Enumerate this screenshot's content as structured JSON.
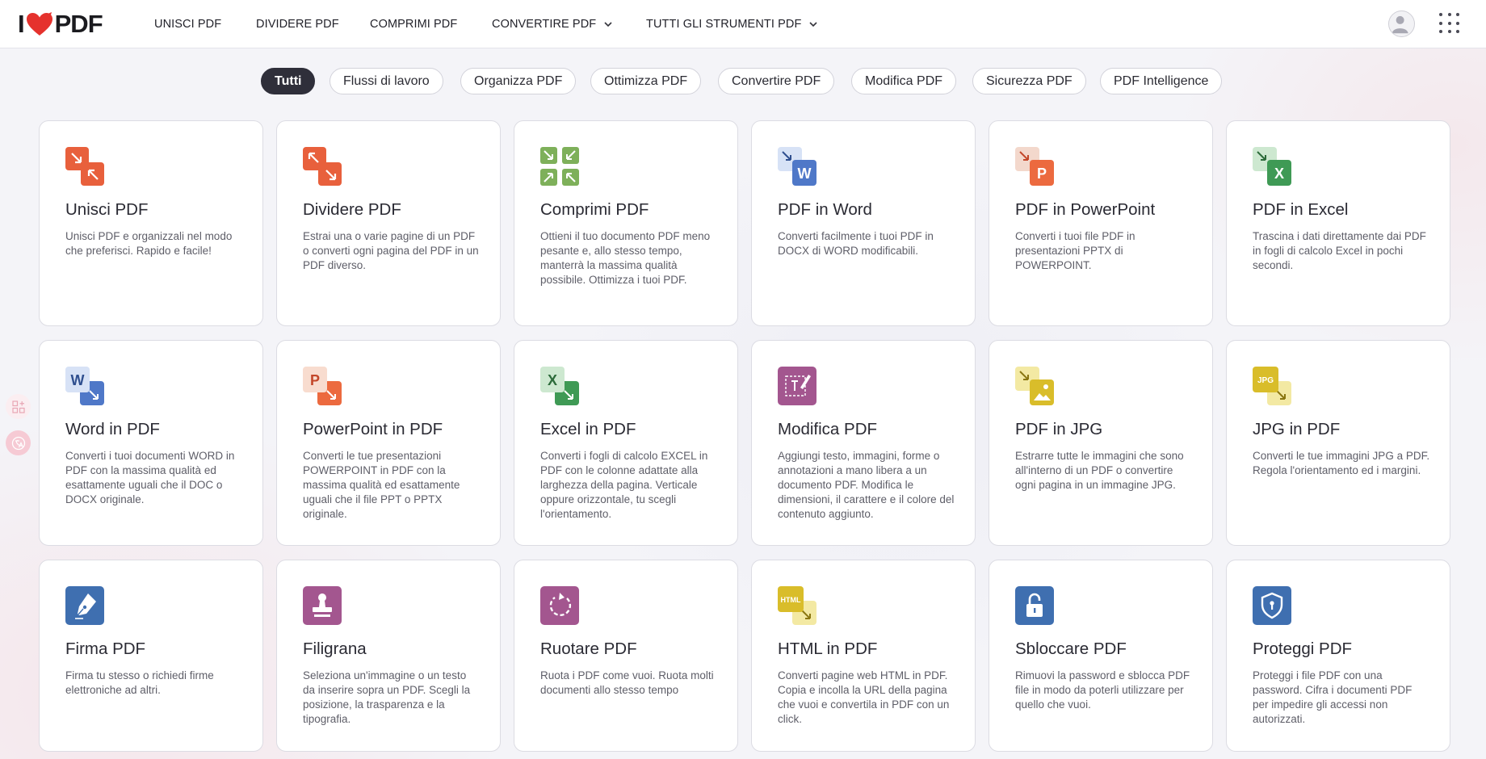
{
  "brand": {
    "logo_left": "I",
    "logo_right": "PDF",
    "accent": "#e5322d"
  },
  "nav": {
    "items": [
      {
        "label": "UNISCI PDF"
      },
      {
        "label": "DIVIDERE PDF"
      },
      {
        "label": "COMPRIMI PDF"
      },
      {
        "label": "CONVERTIRE PDF"
      },
      {
        "label": "TUTTI GLI STRUMENTI PDF"
      }
    ]
  },
  "filters": [
    {
      "label": "Tutti",
      "active": true
    },
    {
      "label": "Flussi di lavoro"
    },
    {
      "label": "Organizza PDF"
    },
    {
      "label": "Ottimizza PDF"
    },
    {
      "label": "Convertire PDF"
    },
    {
      "label": "Modifica PDF"
    },
    {
      "label": "Sicurezza PDF"
    },
    {
      "label": "PDF Intelligence"
    }
  ],
  "tools": [
    {
      "title": "Unisci PDF",
      "desc": "Unisci PDF e organizzali nel modo che preferisci. Rapido e facile!",
      "icon": "merge-icon",
      "color": "#e8603c"
    },
    {
      "title": "Dividere PDF",
      "desc": "Estrai una o varie pagine di un PDF o converti ogni pagina del PDF in un PDF diverso.",
      "icon": "split-icon",
      "color": "#e8603c"
    },
    {
      "title": "Comprimi PDF",
      "desc": "Ottieni il tuo documento PDF meno pesante e, allo stesso tempo, manterrà la massima qualità possibile. Ottimizza i tuoi PDF.",
      "icon": "compress-icon",
      "color": "#7eb05a"
    },
    {
      "title": "PDF in Word",
      "desc": "Converti facilmente i tuoi PDF in DOCX di WORD modificabili.",
      "icon": "word-icon",
      "color": "#4f78c8",
      "letter": "W"
    },
    {
      "title": "PDF in PowerPoint",
      "desc": "Converti i tuoi file PDF in presentazioni PPTX di POWERPOINT.",
      "icon": "powerpoint-icon",
      "color": "#ec6a3f",
      "letter": "P"
    },
    {
      "title": "PDF in Excel",
      "desc": "Trascina i dati direttamente dai PDF in fogli di calcolo Excel in pochi secondi.",
      "icon": "excel-icon",
      "color": "#3f9a55",
      "letter": "X"
    },
    {
      "title": "Word in PDF",
      "desc": "Converti i tuoi documenti WORD in PDF con la massima qualità ed esattamente uguali che il DOC o DOCX originale.",
      "icon": "word-icon",
      "color": "#4f78c8",
      "letter": "W"
    },
    {
      "title": "PowerPoint in PDF",
      "desc": "Converti le tue presentazioni POWERPOINT in PDF con la massima qualità ed esattamente uguali che il file PPT o PPTX originale.",
      "icon": "powerpoint-icon",
      "color": "#ec6a3f",
      "letter": "P"
    },
    {
      "title": "Excel in PDF",
      "desc": "Converti i fogli di calcolo EXCEL in PDF con le colonne adattate alla larghezza della pagina. Verticale oppure orizzontale, tu scegli l'orientamento.",
      "icon": "excel-icon",
      "color": "#3f9a55",
      "letter": "X"
    },
    {
      "title": "Modifica PDF",
      "desc": "Aggiungi testo, immagini, forme o annotazioni a mano libera a un documento PDF. Modifica le dimensioni, il carattere e il colore del contenuto aggiunto.",
      "icon": "edit-icon",
      "color": "#a3568f"
    },
    {
      "title": "PDF in JPG",
      "desc": "Estrarre tutte le immagini che sono all'interno di un PDF o convertire ogni pagina in un immagine JPG.",
      "icon": "image-icon",
      "color": "#d9bd2a"
    },
    {
      "title": "JPG in PDF",
      "desc": "Converti le tue immagini JPG a PDF. Regola l'orientamento ed i margini.",
      "icon": "jpg-icon",
      "color": "#d9bd2a",
      "letter": "JPG"
    },
    {
      "title": "Firma PDF",
      "desc": "Firma tu stesso o richiedi firme elettroniche ad altri.",
      "icon": "pen-icon",
      "color": "#3f6fb0"
    },
    {
      "title": "Filigrana",
      "desc": "Seleziona un'immagine o un testo da inserire sopra un PDF. Scegli la posizione, la trasparenza e la tipografia.",
      "icon": "stamp-icon",
      "color": "#a3568f"
    },
    {
      "title": "Ruotare PDF",
      "desc": "Ruota i PDF come vuoi. Ruota molti documenti allo stesso tempo",
      "icon": "rotate-icon",
      "color": "#a3568f"
    },
    {
      "title": "HTML in PDF",
      "desc": "Converti pagine web HTML in PDF. Copia e incolla la URL della pagina che vuoi e convertila in PDF con un click.",
      "icon": "html-icon",
      "color": "#d9bd2a",
      "letter": "HTML"
    },
    {
      "title": "Sbloccare PDF",
      "desc": "Rimuovi la password e sblocca PDF file in modo da poterli utilizzare per quello che vuoi.",
      "icon": "unlock-icon",
      "color": "#3f6fb0"
    },
    {
      "title": "Proteggi PDF",
      "desc": "Proteggi i file PDF con una password. Cifra i documenti PDF per impedire gli accessi non autorizzati.",
      "icon": "shield-icon",
      "color": "#3f6fb0"
    }
  ]
}
